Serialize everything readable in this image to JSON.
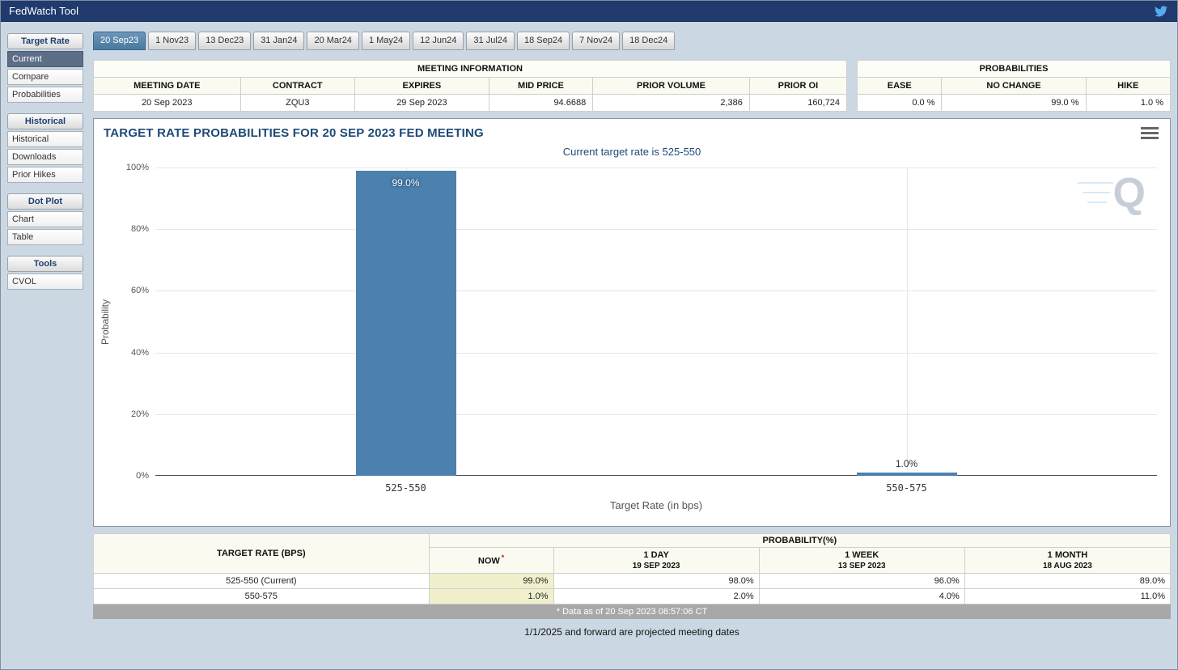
{
  "header": {
    "title": "FedWatch Tool"
  },
  "sidebar": {
    "sections": [
      {
        "header": "Target Rate",
        "items": [
          {
            "label": "Current"
          },
          {
            "label": "Compare"
          },
          {
            "label": "Probabilities"
          }
        ]
      },
      {
        "header": "Historical",
        "items": [
          {
            "label": "Historical"
          },
          {
            "label": "Downloads"
          },
          {
            "label": "Prior Hikes"
          }
        ]
      },
      {
        "header": "Dot Plot",
        "items": [
          {
            "label": "Chart"
          },
          {
            "label": "Table"
          }
        ]
      },
      {
        "header": "Tools",
        "items": [
          {
            "label": "CVOL"
          }
        ]
      }
    ]
  },
  "tabs": [
    {
      "label": "20 Sep23"
    },
    {
      "label": "1 Nov23"
    },
    {
      "label": "13 Dec23"
    },
    {
      "label": "31 Jan24"
    },
    {
      "label": "20 Mar24"
    },
    {
      "label": "1 May24"
    },
    {
      "label": "12 Jun24"
    },
    {
      "label": "31 Jul24"
    },
    {
      "label": "18 Sep24"
    },
    {
      "label": "7 Nov24"
    },
    {
      "label": "18 Dec24"
    }
  ],
  "meeting_info": {
    "title": "MEETING INFORMATION",
    "columns": [
      "MEETING DATE",
      "CONTRACT",
      "EXPIRES",
      "MID PRICE",
      "PRIOR VOLUME",
      "PRIOR OI"
    ],
    "values": [
      "20 Sep 2023",
      "ZQU3",
      "29 Sep 2023",
      "94.6688",
      "2,386",
      "160,724"
    ]
  },
  "probabilities_panel": {
    "title": "PROBABILITIES",
    "columns": [
      "EASE",
      "NO CHANGE",
      "HIKE"
    ],
    "values": [
      "0.0 %",
      "99.0 %",
      "1.0 %"
    ]
  },
  "chart": {
    "title": "TARGET RATE PROBABILITIES FOR 20 SEP 2023 FED MEETING",
    "subtitle": "Current target rate is 525-550",
    "ylabel": "Probability",
    "xlabel": "Target Rate (in bps)",
    "yticks": [
      "100%",
      "80%",
      "60%",
      "40%",
      "20%",
      "0%"
    ],
    "watermark": "Q"
  },
  "chart_data": {
    "type": "bar",
    "title": "TARGET RATE PROBABILITIES FOR 20 SEP 2023 FED MEETING",
    "subtitle": "Current target rate is 525-550",
    "xlabel": "Target Rate (in bps)",
    "ylabel": "Probability",
    "categories": [
      "525-550",
      "550-575"
    ],
    "values": [
      99.0,
      1.0
    ],
    "labels": [
      "99.0%",
      "1.0%"
    ],
    "ylim": [
      0,
      100
    ],
    "grid": true,
    "legend": "none",
    "bar_color": "#4d81ad"
  },
  "probability_table": {
    "rate_header": "TARGET RATE (BPS)",
    "group_header": "PROBABILITY(%)",
    "col_headers": [
      {
        "line1": "NOW",
        "sup": "*",
        "line2": ""
      },
      {
        "line1": "1 DAY",
        "line2": "19 SEP 2023"
      },
      {
        "line1": "1 WEEK",
        "line2": "13 SEP 2023"
      },
      {
        "line1": "1 MONTH",
        "line2": "18 AUG 2023"
      }
    ],
    "rows": [
      {
        "rate": "525-550 (Current)",
        "now": "99.0%",
        "day": "98.0%",
        "week": "96.0%",
        "month": "89.0%"
      },
      {
        "rate": "550-575",
        "now": "1.0%",
        "day": "2.0%",
        "week": "4.0%",
        "month": "11.0%"
      }
    ],
    "footnote": "* Data as of 20 Sep 2023 08:57:06 CT"
  },
  "footer": {
    "note": "1/1/2025 and forward are projected meeting dates"
  }
}
